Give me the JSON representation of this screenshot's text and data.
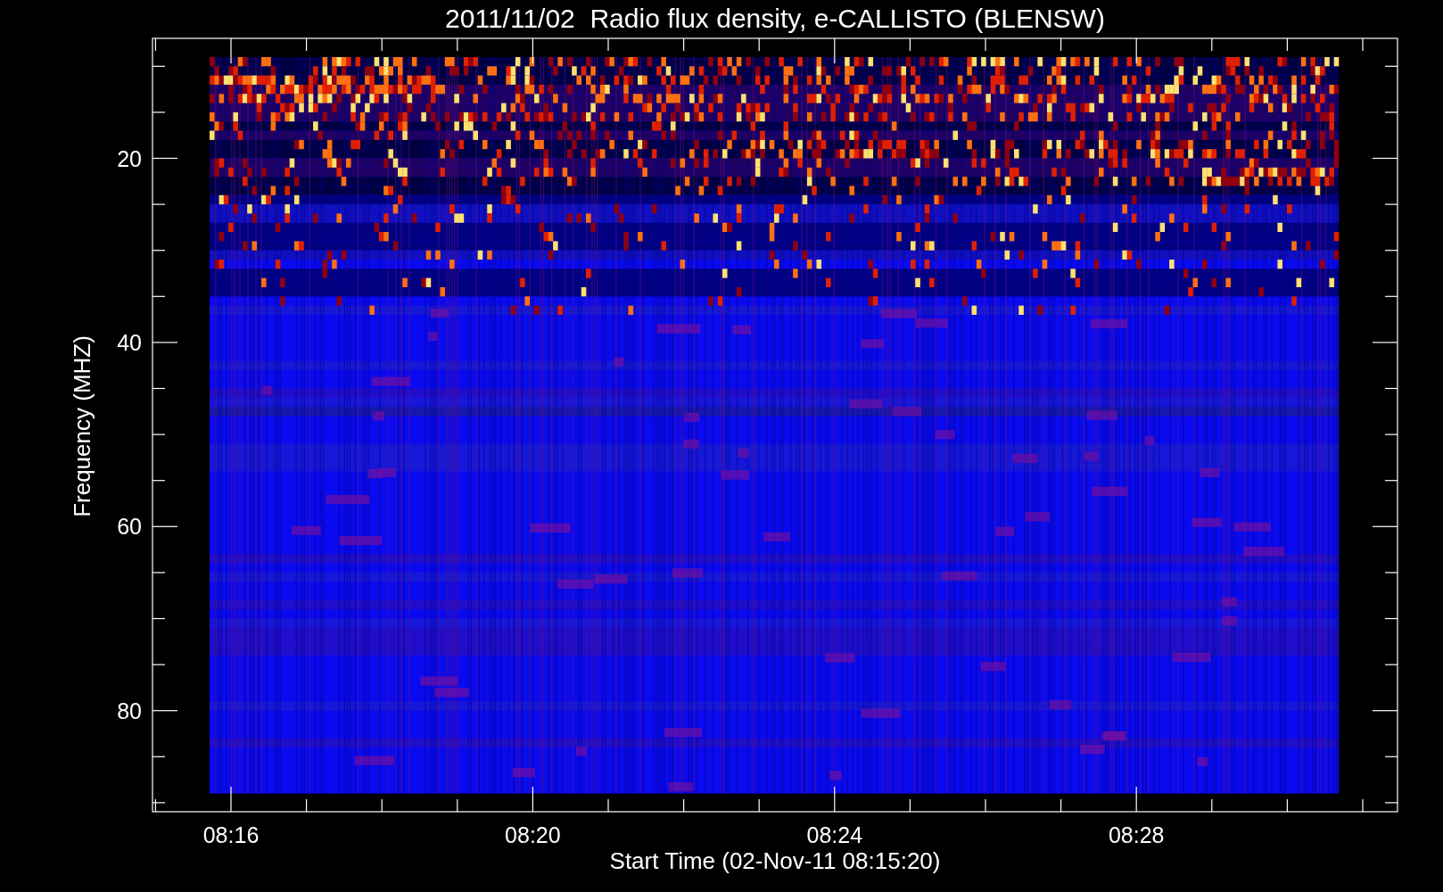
{
  "title": "2011/11/02  Radio flux density, e-CALLISTO (BLENSW)",
  "ylabel": "Frequency (MHZ)",
  "xlabel": "Start Time (02-Nov-11 08:15:20)",
  "y_tick_labels": [
    "20",
    "40",
    "60",
    "80"
  ],
  "x_tick_labels": [
    "08:16",
    "08:20",
    "08:24",
    "08:28"
  ]
}
